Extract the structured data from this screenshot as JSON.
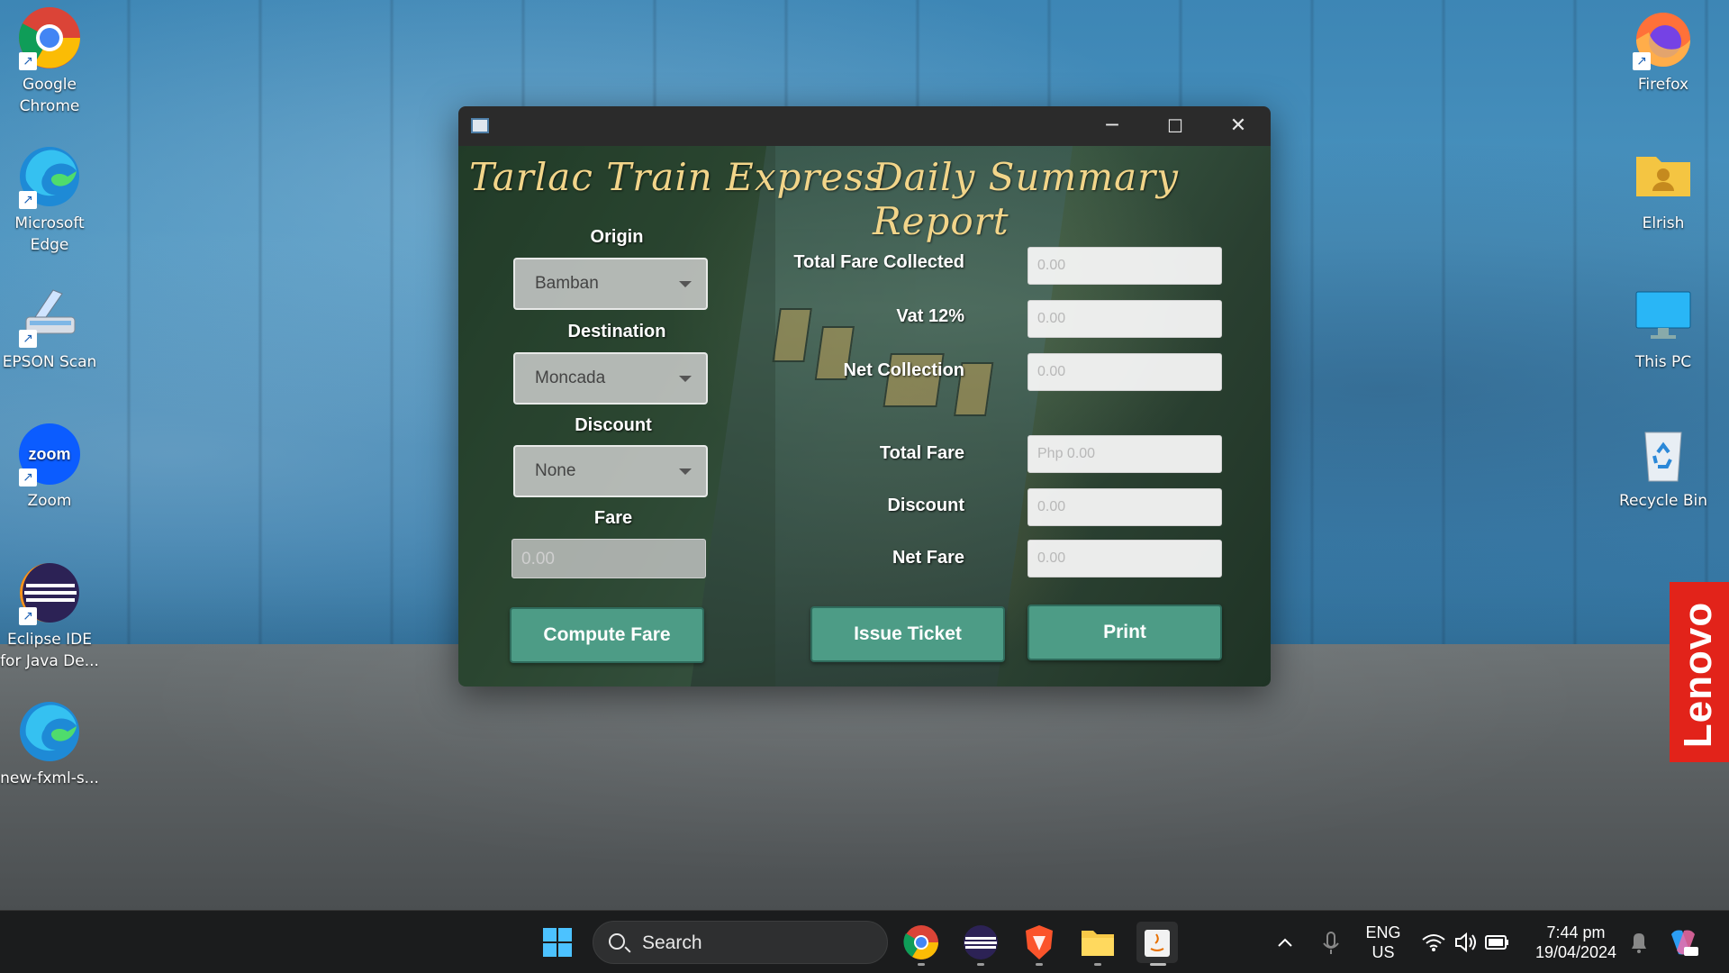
{
  "desktop": {
    "icons_left": [
      {
        "label": "Google Chrome",
        "icon": "chrome-icon"
      },
      {
        "label": "Microsoft Edge",
        "icon": "edge-icon"
      },
      {
        "label": "EPSON Scan",
        "icon": "scanner-icon"
      },
      {
        "label": "Zoom",
        "icon": "zoom-icon"
      },
      {
        "label": "Eclipse IDE for Java De...",
        "icon": "eclipse-icon"
      },
      {
        "label": "new-fxml-s...",
        "icon": "edge-icon"
      }
    ],
    "icons_right": [
      {
        "label": "Firefox",
        "icon": "firefox-icon"
      },
      {
        "label": "Elrish",
        "icon": "user-folder-icon"
      },
      {
        "label": "This PC",
        "icon": "monitor-icon"
      },
      {
        "label": "Recycle Bin",
        "icon": "recycle-bin-icon"
      }
    ],
    "brand_badge": "Lenovo"
  },
  "window": {
    "controls": {
      "minimize": "─",
      "maximize": "☐",
      "close": "✕"
    },
    "left_title": "Tarlac Train Express",
    "right_title": "Daily Summary Report",
    "origin": {
      "label": "Origin",
      "value": "Bamban"
    },
    "destination": {
      "label": "Destination",
      "value": "Moncada"
    },
    "discount": {
      "label": "Discount",
      "value": "None"
    },
    "fare": {
      "label": "Fare",
      "placeholder": "0.00"
    },
    "summary_fields": [
      {
        "label": "Total Fare Collected",
        "placeholder": "0.00"
      },
      {
        "label": "Vat 12%",
        "placeholder": "0.00"
      },
      {
        "label": "Net Collection",
        "placeholder": "0.00"
      },
      {
        "label": "Total Fare",
        "placeholder": "Php 0.00"
      },
      {
        "label": "Discount",
        "placeholder": "0.00"
      },
      {
        "label": "Net Fare",
        "placeholder": "0.00"
      }
    ],
    "buttons": {
      "compute": "Compute Fare",
      "issue": "Issue Ticket",
      "print": "Print"
    }
  },
  "taskbar": {
    "search_label": "Search",
    "lang": "ENG",
    "region": "US",
    "time": "7:44 pm",
    "date": "19/04/2024",
    "apps": [
      "windows-start-icon",
      "chrome-icon",
      "eclipse-icon",
      "brave-icon",
      "file-explorer-icon",
      "java-icon"
    ]
  }
}
